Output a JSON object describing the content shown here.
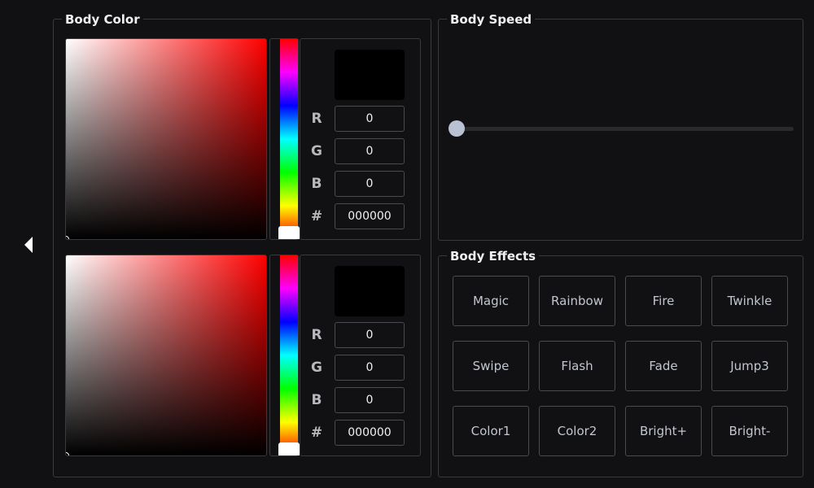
{
  "body_color": {
    "title": "Body Color",
    "pickers": [
      {
        "swatch_color": "#000000",
        "r_label": "R",
        "r_value": "0",
        "g_label": "G",
        "g_value": "0",
        "b_label": "B",
        "b_value": "0",
        "hex_label": "#",
        "hex_value": "000000"
      },
      {
        "swatch_color": "#000000",
        "r_label": "R",
        "r_value": "0",
        "g_label": "G",
        "g_value": "0",
        "b_label": "B",
        "b_value": "0",
        "hex_label": "#",
        "hex_value": "000000"
      }
    ],
    "hue_base": "#ff0000"
  },
  "body_speed": {
    "title": "Body Speed",
    "slider_value_fraction": 0.0,
    "thumb_color": "#b9c2d2"
  },
  "body_effects": {
    "title": "Body Effects",
    "buttons": [
      "Magic",
      "Rainbow",
      "Fire",
      "Twinkle",
      "Swipe",
      "Flash",
      "Fade",
      "Jump3",
      "Color1",
      "Color2",
      "Bright+",
      "Bright-"
    ]
  },
  "icons": {
    "back": "caret-left-icon"
  }
}
